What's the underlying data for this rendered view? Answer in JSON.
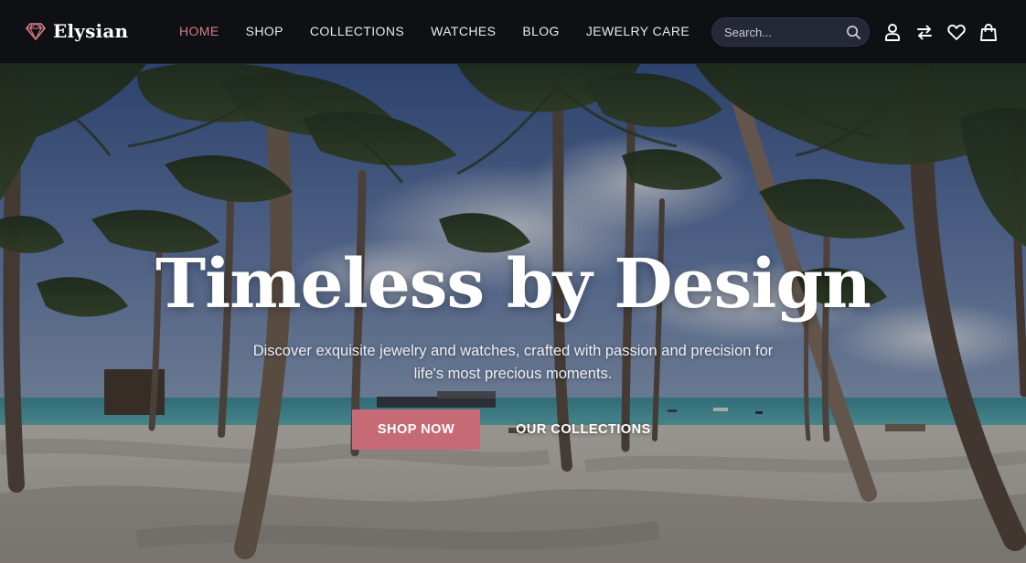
{
  "brand": {
    "name": "Elysian",
    "icon": "diamond-icon",
    "icon_color": "#d57d87"
  },
  "nav": {
    "items": [
      {
        "label": "HOME",
        "active": true
      },
      {
        "label": "SHOP",
        "active": false
      },
      {
        "label": "COLLECTIONS",
        "active": false
      },
      {
        "label": "WATCHES",
        "active": false
      },
      {
        "label": "BLOG",
        "active": false
      },
      {
        "label": "JEWELRY CARE",
        "active": false
      }
    ]
  },
  "search": {
    "placeholder": "Search...",
    "value": "",
    "icon": "search-icon"
  },
  "header_icons": [
    "user-icon",
    "compare-arrows-icon",
    "heart-icon",
    "shopping-bag-icon"
  ],
  "hero": {
    "title": "Timeless by Design",
    "subtitle": "Discover exquisite jewelry and watches, crafted with passion and precision for life's most precious moments.",
    "primary_button": "SHOP NOW",
    "secondary_button": "OUR COLLECTIONS",
    "background": "tropical-beach-palm-trees-photo"
  },
  "colors": {
    "accent": "#d57d87",
    "button": "#c66a76",
    "header_bg": "#0f1013",
    "search_bg": "#252837"
  }
}
